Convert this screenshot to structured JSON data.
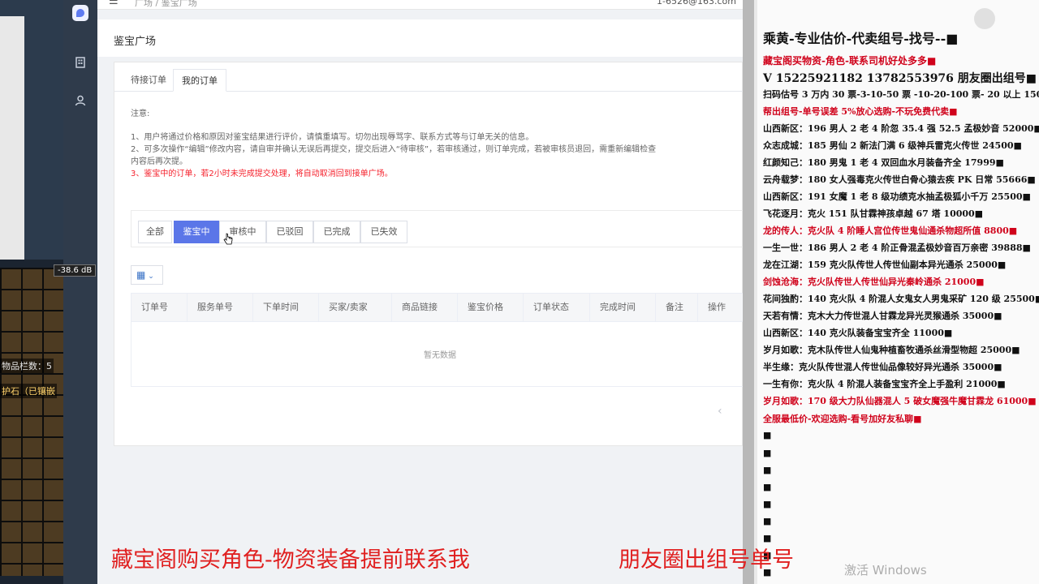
{
  "game": {
    "db_label": "-38.6 dB",
    "inventory_text": "物品栏数：5",
    "item_text": "护石（已镶嵌"
  },
  "sidebar": {
    "icons": [
      "building-icon",
      "user-icon"
    ]
  },
  "topbar": {
    "crumb": "广场 / 鉴宝广场",
    "email": "1-6526@163.com"
  },
  "page": {
    "title": "鉴宝广场"
  },
  "tabs": [
    {
      "label": "待接订单"
    },
    {
      "label": "我的订单"
    }
  ],
  "notice": {
    "head": "注意:",
    "line1": "1、用户将通过价格和原因对鉴宝结果进行评价，请慎重填写。切勿出现辱骂字、联系方式等与订单无关的信息。",
    "line2a": "2、可多次操作“编辑”修改内容，请自审并确认无误后再提交，提交后进入“待审核”，若审核通过，则订单完成，若被审核员退回，需重新编辑检查",
    "line2b": "内容后再次提。",
    "line3": "3、鉴宝中的订单，若2小时未完成提交处理，将自动取消回到接单广场。"
  },
  "filters": [
    "全部",
    "鉴宝中",
    "审核中",
    "已驳回",
    "已完成",
    "已失效"
  ],
  "table": {
    "columns": [
      "订单号",
      "服务单号",
      "下单时间",
      "买家/卖家",
      "商品链接",
      "鉴宝价格",
      "订单状态",
      "完成时间",
      "备注",
      "操作"
    ],
    "empty_text": "暂无数据"
  },
  "overlay": {
    "lines": [
      "乘黄-专业估价-代卖组号-找号--■",
      "藏宝阁买物资-角色-联系司机好处多多■",
      "V 15225921182   13782553976 朋友圈出组号■",
      "扫码估号 3 万内 30 票-3-10-50 票  -10-20-100 票- 20 以上 150■",
      "帮出组号-单号误差 5%放心选购-不玩免费代卖■",
      "山西新区：196 男人 2 老 4 阶忽 35.4 强 52.5 孟极妙音 52000■",
      "众志成城：185 男仙 2 新法门满 6 级神兵雷克火传世 24500■",
      "红颜知己：180 男鬼 1 老 4 双回血水月装备齐全 17999■",
      "云舟载梦：180 女人强毒克火传世白骨心猿去疾 PK 日常 55666■",
      "山西新区：191 女魔 1 老 8 级功绩克水抽孟极狐小千万 25500■",
      "飞花逐月：克火 151 队甘霖神孩卓越 67 塔 10000■",
      "龙的传人：克火队 4 阶睡人宫位传世鬼仙通杀物超所值 8800■",
      "一生一世：186 男人 2 老 4 阶正骨混孟极妙音百万亲密 39888■",
      "龙在江湖：159 克火队传世人传世仙副本异光通杀 25000■",
      "剑蚀沧海：克火队传世人传世仙异光秦岭通杀 21000■",
      "花间独酌：140 克火队 4 阶混人女鬼女人男鬼采矿 120 级 25500■",
      "天若有情：克木大力传世混人甘霖龙异光灵猴通杀 35000■",
      "山西新区：140 克火队装备宝宝齐全 11000■",
      "岁月如歌：克木队传世人仙鬼种植畜牧通杀丝滑型物超 25000■",
      "半生缘：克火队传世混人传世仙品像较好异光通杀 35000■",
      "一生有你：克火队 4 阶混人装备宝宝齐全上手盈利 21000■",
      "岁月如歌：170 级大力队仙器混人 5 破女魔强牛魔甘霖龙 61000■",
      "全服最低价-欢迎选购-看号加好友私聊■",
      "■",
      "■",
      "■",
      "■",
      "■",
      "■",
      "■",
      "■",
      "■"
    ]
  },
  "captions": {
    "left": "藏宝阁购买角色-物资装备提前联系我",
    "right": "朋友圈出组号单号",
    "watermark": "激活 Windows"
  },
  "colors": {
    "accent": "#5b76e8",
    "caption_red": "#e02020",
    "overlay_black": "#111111",
    "overlay_red": "#d0021b"
  }
}
